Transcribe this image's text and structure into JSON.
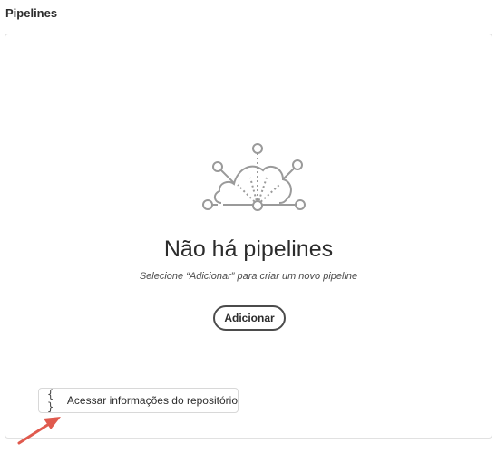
{
  "section": {
    "title": "Pipelines"
  },
  "empty_state": {
    "illustration_icon": "cloud-pipeline-icon",
    "title": "Não há pipelines",
    "description": "Selecione “Adicionar” para criar um novo pipeline",
    "add_button_label": "Adicionar"
  },
  "repo_button": {
    "icon": "braces-icon",
    "icon_glyph": "{ }",
    "label": "Acessar informações do repositório"
  },
  "annotation": {
    "icon": "arrow-icon",
    "color": "#e05a4e"
  },
  "colors": {
    "text": "#2c2c2c",
    "border": "#e1e1e1",
    "illustration": "#9a9a9a"
  }
}
